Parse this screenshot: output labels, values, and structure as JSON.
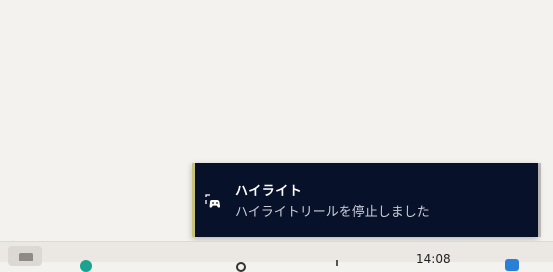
{
  "notification": {
    "app_title": "ハイライト",
    "message": "ハイライトリールを停止しました",
    "icon": "game-highlight-icon",
    "accent_color": "#c9c27a",
    "background_color": "#07112a"
  },
  "taskbar": {
    "clock_time": "14:08",
    "icons": [
      "widgets-icon",
      "app-icon",
      "search-icon",
      "app-icon",
      "notification-app-icon"
    ]
  }
}
